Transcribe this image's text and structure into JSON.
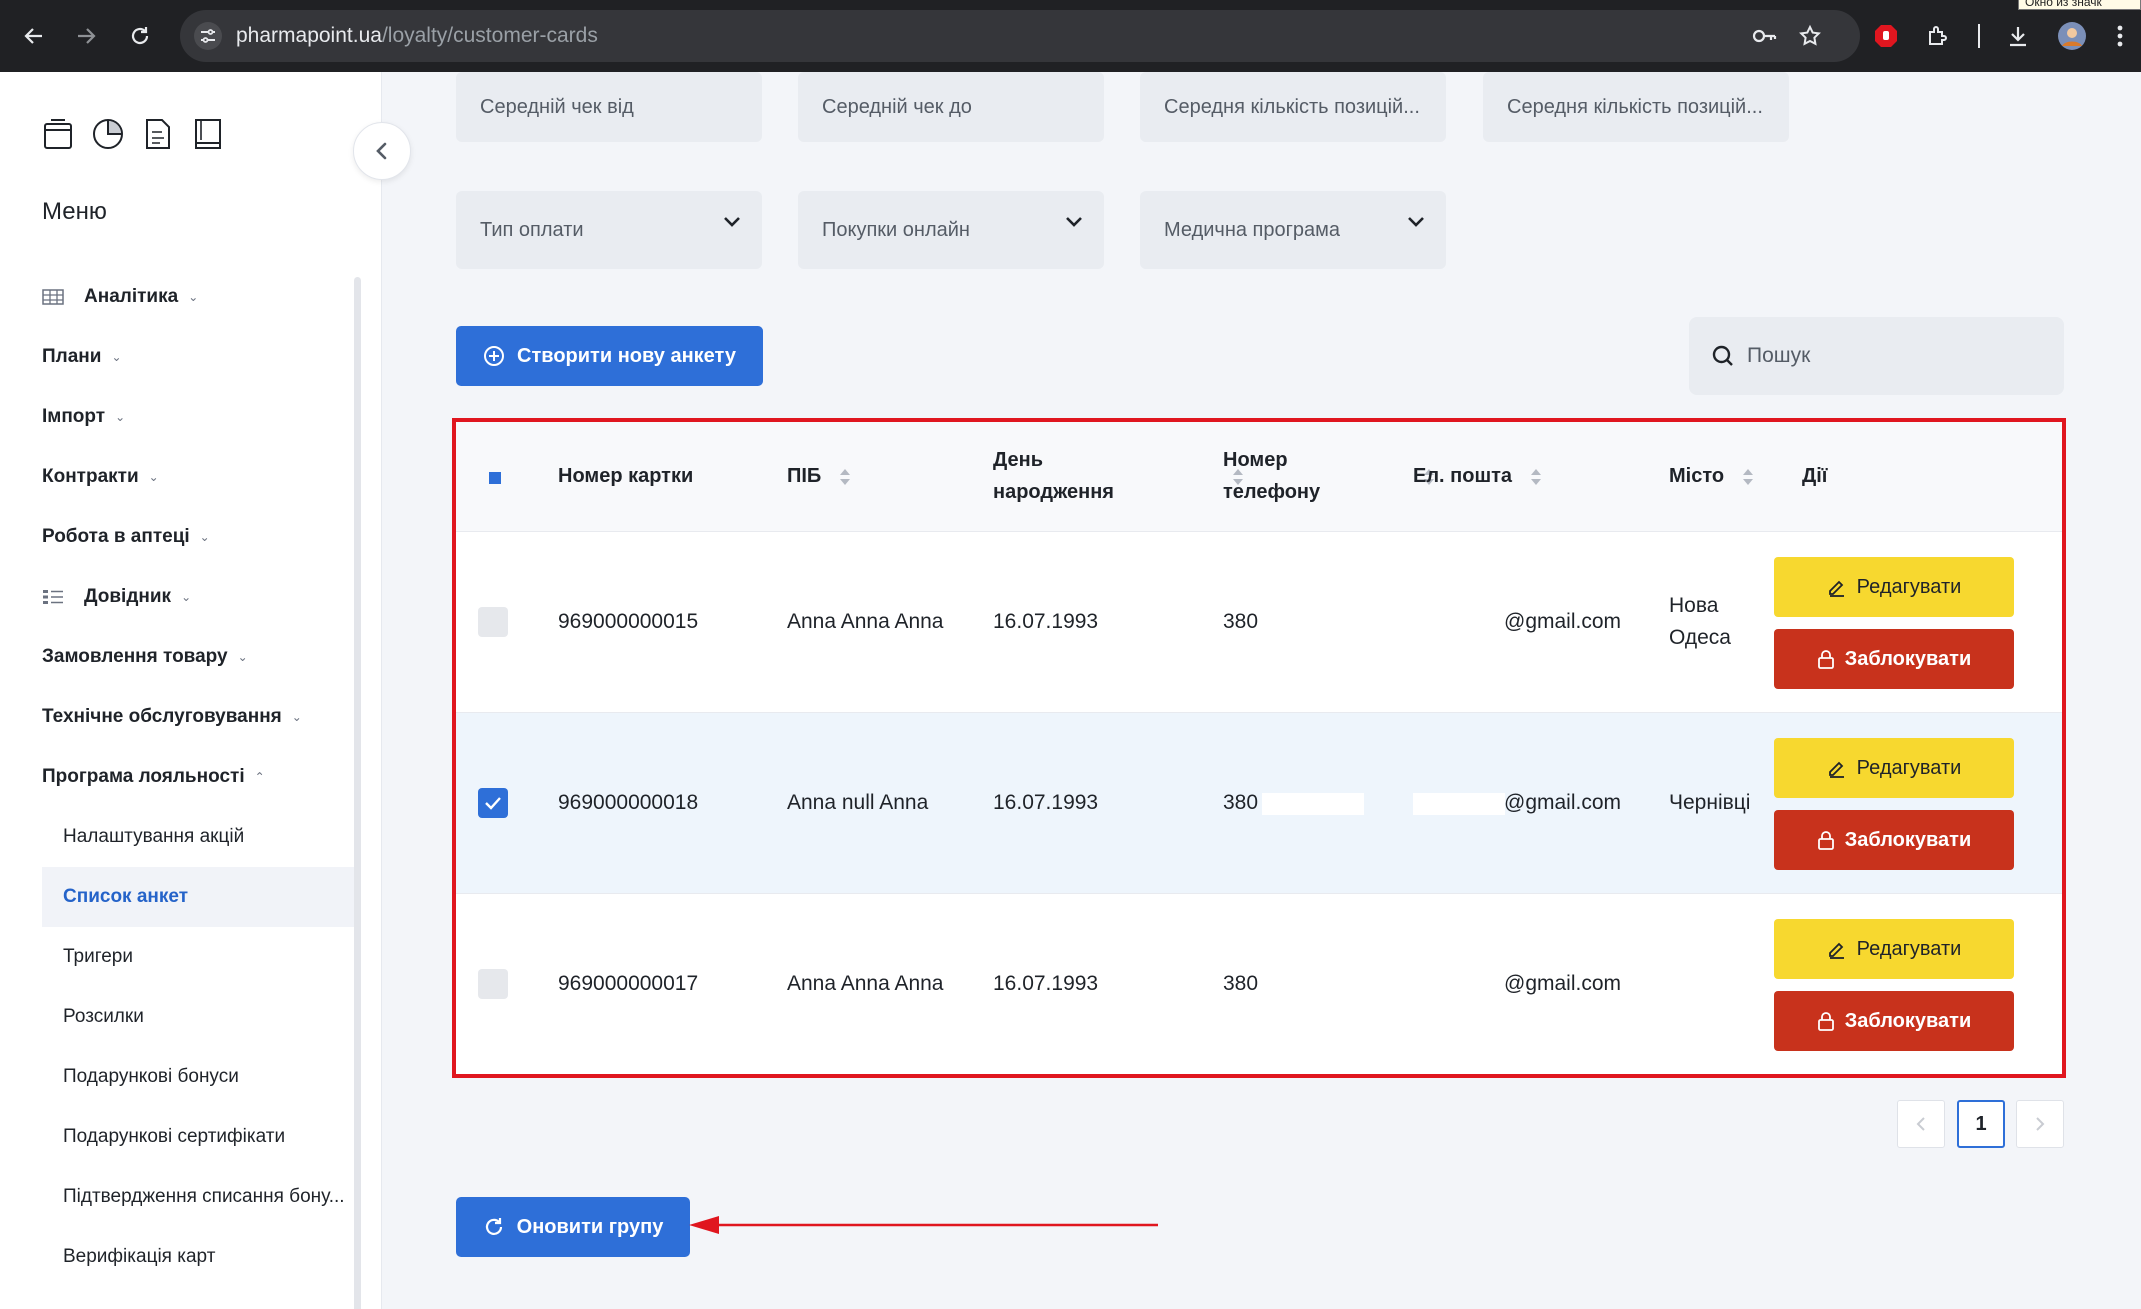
{
  "browser": {
    "url_host": "pharmapoint.ua",
    "url_path": "/loyalty/customer-cards",
    "tooltip_fragment": "Окно из значк"
  },
  "sidebar": {
    "menu_title": "Меню",
    "items": [
      {
        "label": "Аналітика"
      },
      {
        "label": "Плани"
      },
      {
        "label": "Імпорт"
      },
      {
        "label": "Контракти"
      },
      {
        "label": "Робота в аптеці"
      },
      {
        "label": "Довідник"
      },
      {
        "label": "Замовлення товару"
      },
      {
        "label": "Технічне обслуговування"
      },
      {
        "label": "Програма лояльності"
      }
    ],
    "subitems": [
      {
        "label": "Налаштування акцій"
      },
      {
        "label": "Список анкет"
      },
      {
        "label": "Тригери"
      },
      {
        "label": "Розсилки"
      },
      {
        "label": "Подарункові бонуси"
      },
      {
        "label": "Подарункові сертифікати"
      },
      {
        "label": "Підтвердження списання бону..."
      },
      {
        "label": "Верифікація карт"
      }
    ]
  },
  "filters": {
    "avg_check_from": "Середній чек від",
    "avg_check_to": "Середній чек до",
    "avg_items_1": "Середня кількість позицій...",
    "avg_items_2": "Середня кількість позицій...",
    "payment_type": "Тип оплати",
    "online_purchases": "Покупки онлайн",
    "medical_program": "Медична програма"
  },
  "actions": {
    "create_label": "Створити нову анкету",
    "search_placeholder": "Пошук",
    "update_group_label": "Оновити групу"
  },
  "table": {
    "columns": {
      "card_number": "Номер картки",
      "name": "ПІБ",
      "birthday_1": "День",
      "birthday_2": "народження",
      "phone_1": "Номер",
      "phone_2": "телефону",
      "email": "Ел. пошта",
      "city": "Місто",
      "actions": "Дії"
    },
    "rows": [
      {
        "card": "969000000015",
        "name": "Anna Anna Anna",
        "birthday": "16.07.1993",
        "phone": "380",
        "email": "@gmail.com",
        "city_1": "Нова",
        "city_2": "Одеса",
        "selected": false
      },
      {
        "card": "969000000018",
        "name": "Anna null Anna",
        "birthday": "16.07.1993",
        "phone": "380",
        "email": "@gmail.com",
        "city_1": "Чернівці",
        "city_2": "",
        "selected": true
      },
      {
        "card": "969000000017",
        "name": "Anna Anna Anna",
        "birthday": "16.07.1993",
        "phone": "380",
        "email": "@gmail.com",
        "city_1": "",
        "city_2": "",
        "selected": false
      }
    ],
    "edit_label": "Редагувати",
    "block_label": "Заблокувати"
  },
  "pagination": {
    "current_page": "1"
  },
  "colors": {
    "accent_blue": "#2e6fd8",
    "highlight_red": "#e0161f",
    "edit_yellow": "#f7d82f",
    "block_red": "#c8321c"
  }
}
